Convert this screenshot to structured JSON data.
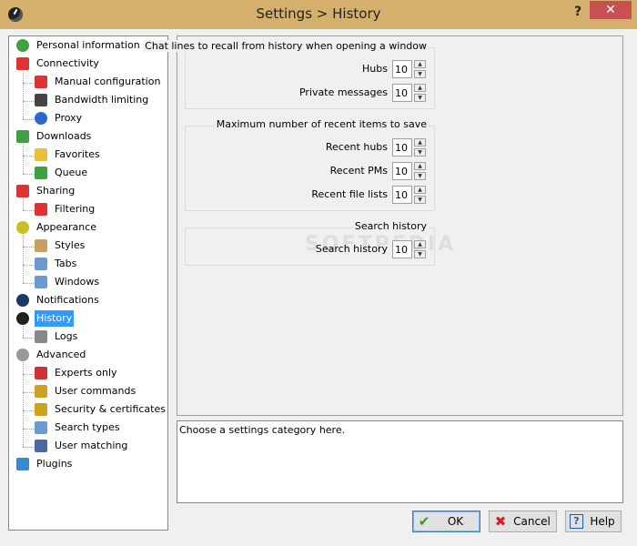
{
  "window": {
    "title": "Settings > History",
    "help_glyph": "?",
    "close_glyph": "✕"
  },
  "tree": {
    "items": [
      {
        "label": "Personal information",
        "icon": "person-icon",
        "color": "#3fa03f",
        "level": 0
      },
      {
        "label": "Connectivity",
        "icon": "antenna-icon",
        "color": "#d33",
        "level": 0
      },
      {
        "label": "Manual configuration",
        "icon": "antenna-icon",
        "color": "#d33",
        "level": 1
      },
      {
        "label": "Bandwidth limiting",
        "icon": "speedometer-icon",
        "color": "#444",
        "level": 1
      },
      {
        "label": "Proxy",
        "icon": "globe-icon",
        "color": "#2a6ad0",
        "level": 1
      },
      {
        "label": "Downloads",
        "icon": "down-arrow-icon",
        "color": "#3fa03f",
        "level": 0
      },
      {
        "label": "Favorites",
        "icon": "folder-star-icon",
        "color": "#e8c040",
        "level": 1
      },
      {
        "label": "Queue",
        "icon": "queue-icon",
        "color": "#3fa03f",
        "level": 1
      },
      {
        "label": "Sharing",
        "icon": "up-arrow-icon",
        "color": "#d33",
        "level": 0
      },
      {
        "label": "Filtering",
        "icon": "up-arrow-icon",
        "color": "#d33",
        "level": 1
      },
      {
        "label": "Appearance",
        "icon": "eye-icon",
        "color": "#c8c020",
        "level": 0
      },
      {
        "label": "Styles",
        "icon": "palette-icon",
        "color": "#c8a060",
        "level": 1
      },
      {
        "label": "Tabs",
        "icon": "tabs-icon",
        "color": "#6a9ad0",
        "level": 1
      },
      {
        "label": "Windows",
        "icon": "windows-icon",
        "color": "#6a9ad0",
        "level": 1
      },
      {
        "label": "Notifications",
        "icon": "notification-icon",
        "color": "#1a3a6a",
        "level": 0
      },
      {
        "label": "History",
        "icon": "clock-icon",
        "color": "#222",
        "level": 0,
        "selected": true
      },
      {
        "label": "Logs",
        "icon": "log-icon",
        "color": "#888",
        "level": 1
      },
      {
        "label": "Advanced",
        "icon": "gear-icon",
        "color": "#999",
        "level": 0
      },
      {
        "label": "Experts only",
        "icon": "tools-icon",
        "color": "#c33",
        "level": 1
      },
      {
        "label": "User commands",
        "icon": "key-icon",
        "color": "#d0a020",
        "level": 1
      },
      {
        "label": "Security & certificates",
        "icon": "lock-icon",
        "color": "#d0a020",
        "level": 1
      },
      {
        "label": "Search types",
        "icon": "magnifier-icon",
        "color": "#6a9ad0",
        "level": 1
      },
      {
        "label": "User matching",
        "icon": "users-icon",
        "color": "#4a6aa0",
        "level": 1
      },
      {
        "label": "Plugins",
        "icon": "plugin-icon",
        "color": "#3a8ad0",
        "level": 0
      }
    ]
  },
  "groups": {
    "chat": {
      "title": "Chat lines to recall from history when opening a window",
      "rows": [
        {
          "label": "Hubs",
          "value": "10"
        },
        {
          "label": "Private messages",
          "value": "10"
        }
      ]
    },
    "recent": {
      "title": "Maximum number of recent items to save",
      "rows": [
        {
          "label": "Recent hubs",
          "value": "10"
        },
        {
          "label": "Recent PMs",
          "value": "10"
        },
        {
          "label": "Recent file lists",
          "value": "10"
        }
      ]
    },
    "search": {
      "title": "Search history",
      "rows": [
        {
          "label": "Search history",
          "value": "10"
        }
      ]
    }
  },
  "description": "Choose a settings category here.",
  "watermark": "SOFTPEDIA",
  "buttons": {
    "ok": "OK",
    "cancel": "Cancel",
    "help": "Help"
  },
  "spin": {
    "up": "▲",
    "down": "▼"
  }
}
